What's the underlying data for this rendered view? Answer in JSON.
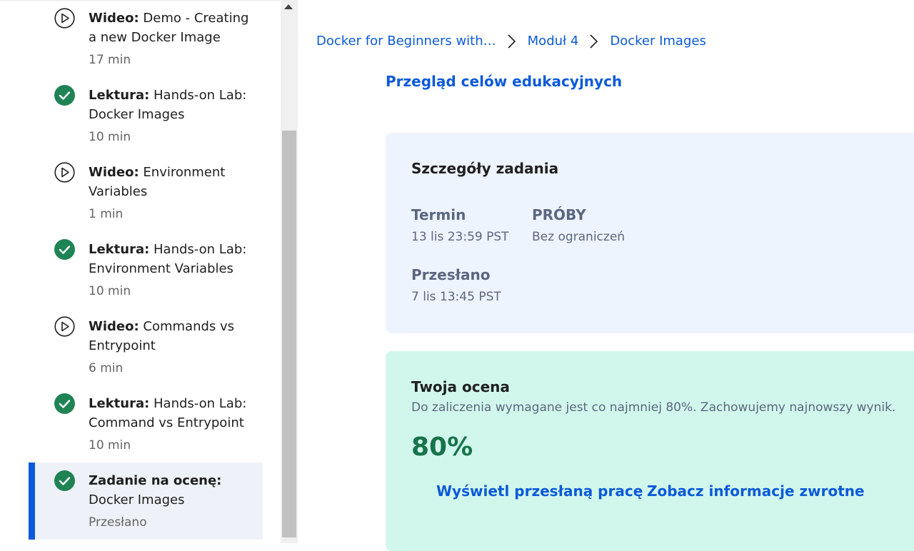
{
  "sidebar": {
    "items": [
      {
        "type": "Wideo:",
        "title_line1": " Demo - Creating",
        "title_line2": "a new Docker Image",
        "meta": "17 min",
        "icon": "play-circle-icon"
      },
      {
        "type": "Lektura:",
        "title_line1": " Hands-on Lab:",
        "title_line2": "Docker Images",
        "meta": "10 min",
        "icon": "check-circle-icon"
      },
      {
        "type": "Wideo:",
        "title_line1": " Environment",
        "title_line2": "Variables",
        "meta": "1 min",
        "icon": "play-circle-icon"
      },
      {
        "type": "Lektura:",
        "title_line1": " Hands-on Lab:",
        "title_line2": "Environment Variables",
        "meta": "10 min",
        "icon": "check-circle-icon"
      },
      {
        "type": "Wideo:",
        "title_line1": " Commands vs",
        "title_line2": "Entrypoint",
        "meta": "6 min",
        "icon": "play-circle-icon"
      },
      {
        "type": "Lektura:",
        "title_line1": " Hands-on Lab:",
        "title_line2": "Command vs Entrypoint",
        "meta": "10 min",
        "icon": "check-circle-icon"
      },
      {
        "type": "Zadanie na ocenę:",
        "title_line1": "",
        "title_line2": "Docker Images",
        "meta": "Przesłano",
        "icon": "check-circle-icon",
        "active": true
      }
    ]
  },
  "breadcrumb": {
    "course": "Docker for Beginners with…",
    "module": "Moduł 4",
    "page": "Docker Images"
  },
  "main": {
    "partial_link": "Przegląd celów edukacyjnych",
    "details": {
      "title": "Szczegóły zadania",
      "due_label": "Termin",
      "due_value": "13 lis 23:59 PST",
      "attempts_label": "PRÓBY",
      "attempts_value": "Bez ograniczeń",
      "submitted_label": "Przesłano",
      "submitted_value": "7 lis 13:45 PST"
    },
    "grade": {
      "title": "Twoja ocena",
      "description": "Do zaliczenia wymagane jest co najmniej 80%. Zachowujemy najnowszy wynik.",
      "value": "80%",
      "view_submission": "Wyświetl przesłaną pracę",
      "view_feedback": "Zobacz informacje zwrotne"
    }
  },
  "colors": {
    "accent": "#0b5ad9",
    "success": "#1f8354",
    "details_bg": "#eef4fd",
    "grade_bg": "#d1f7ec"
  }
}
